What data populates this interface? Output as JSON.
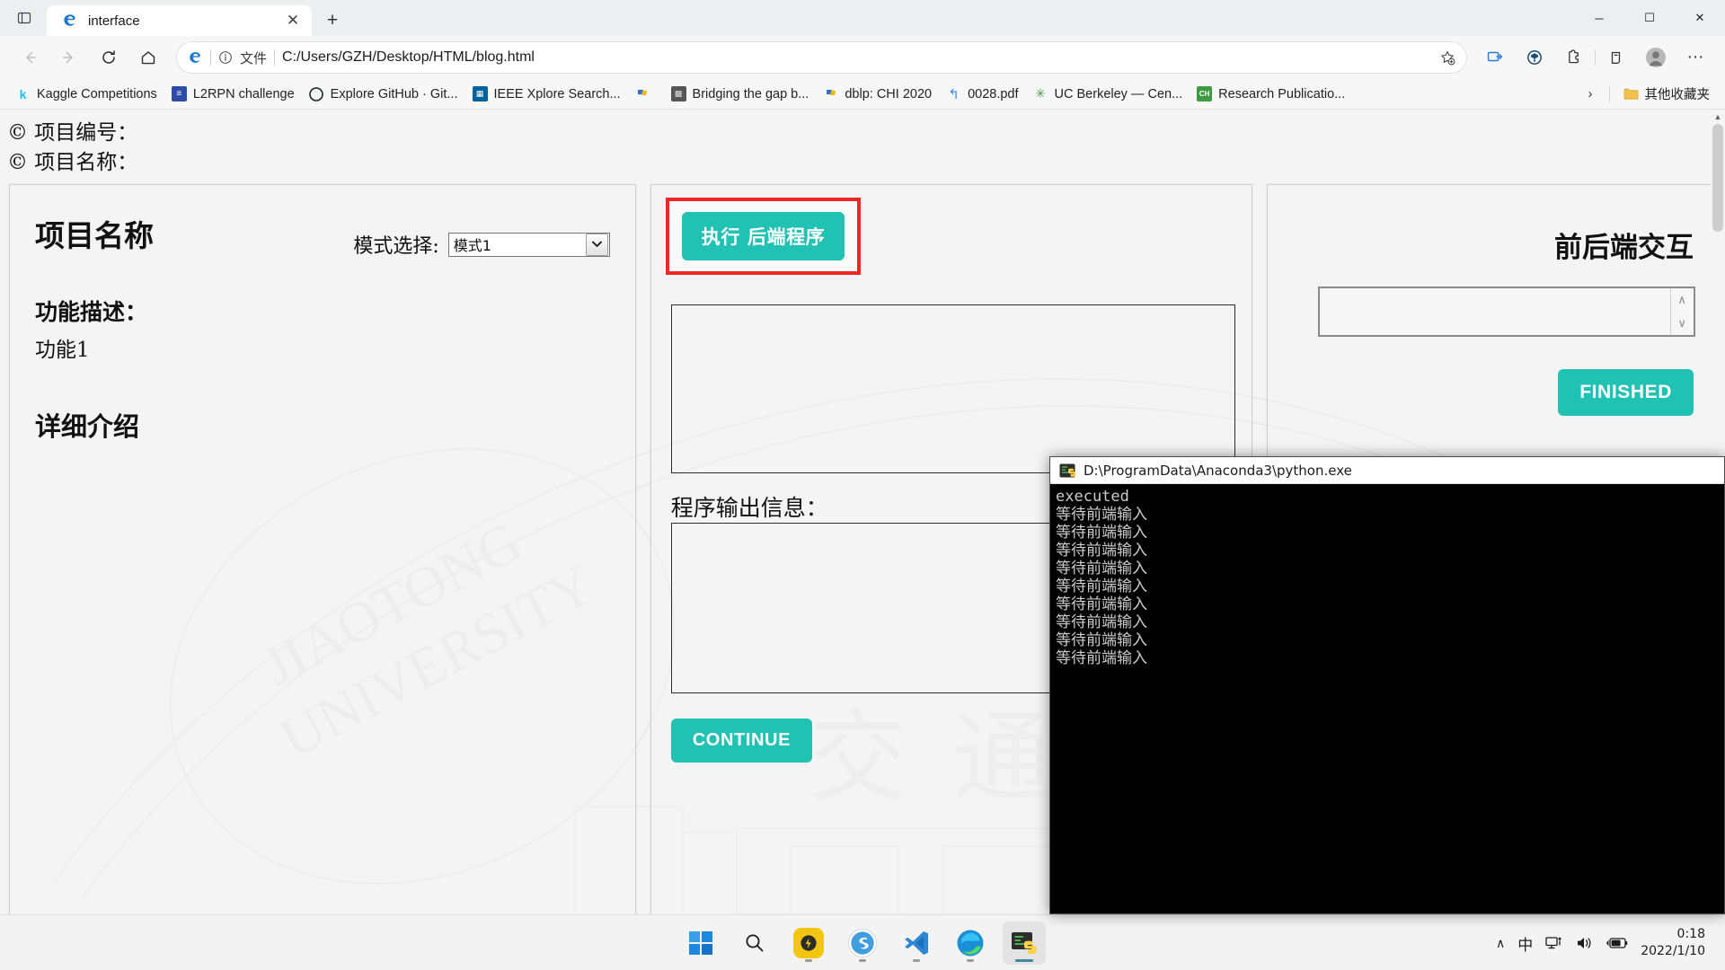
{
  "browser": {
    "tab": {
      "title": "interface",
      "favicon": "ie-edge-legacy-icon",
      "close_label": "✕"
    },
    "new_tab_label": "+",
    "tab_list_icon": "tab-list-icon",
    "window_controls": {
      "minimize": "─",
      "maximize": "☐",
      "close": "✕"
    },
    "toolbar": {
      "back": "←",
      "forward": "→",
      "refresh": "⟳",
      "home": "⌂",
      "site_icon": "ie-compat-icon",
      "info_icon": "ⓘ",
      "file_label": "文件",
      "url": "C:/Users/GZH/Desktop/HTML/blog.html",
      "star_icon": "add-favorite-icon",
      "collections": "collections-icon",
      "browser_essentials": "browser-essentials-icon",
      "extensions": "extensions-icon",
      "split_screen": "split-screen-icon",
      "profile": "profile-avatar",
      "settings_more": "···"
    },
    "bookmarks": [
      {
        "label": "Kaggle Competitions",
        "icon": "kaggle-icon",
        "color": "#20beff",
        "glyph": "k"
      },
      {
        "label": "L2RPN challenge",
        "icon": "l2rpn-icon",
        "color": "#2f4ba8",
        "glyph": "▤"
      },
      {
        "label": "Explore GitHub · Git...",
        "icon": "github-icon",
        "color": "#1b1f23",
        "glyph": "●"
      },
      {
        "label": "IEEE Xplore Search...",
        "icon": "ieee-icon",
        "color": "#00629b",
        "glyph": "█"
      },
      {
        "label": "",
        "icon": "bookmark-flag-icon",
        "color": "#2f6fd0",
        "glyph": "◤"
      },
      {
        "label": "Bridging the gap b...",
        "icon": "document-thumb-icon",
        "color": "#777777",
        "glyph": "▩"
      },
      {
        "label": "dblp: CHI 2020",
        "icon": "bookmark-flag-icon",
        "color": "#2f6fd0",
        "glyph": "◤"
      },
      {
        "label": "0028.pdf",
        "icon": "redirect-arrow-icon",
        "color": "#3b8ae8",
        "glyph": "↩"
      },
      {
        "label": "UC Berkeley — Cen...",
        "icon": "berkeley-icon",
        "color": "#43a047",
        "glyph": "✽"
      },
      {
        "label": "Research Publicatio...",
        "icon": "research-icon",
        "color": "#3f9b42",
        "glyph": "CH"
      }
    ],
    "bookmarks_overflow_icon": "›",
    "other_favorites": {
      "label": "其他收藏夹",
      "icon": "folder-icon"
    }
  },
  "page": {
    "header_lines": [
      "© 项目编号：",
      "© 项目名称："
    ],
    "left_panel": {
      "title": "项目名称",
      "feature_heading": "功能描述：",
      "feature_text": "功能1",
      "detail_heading": "详细介绍",
      "mode_label": "模式选择:",
      "mode_value": "模式1",
      "mode_options": [
        "模式1"
      ],
      "mode_arrow": "⌄"
    },
    "mid_panel": {
      "exec_button": "执行 后端程序",
      "highlight_color": "#ef2626",
      "output_label": "程序输出信息：",
      "input_box_value": "",
      "output_box_value": "",
      "continue_button": "CONTINUE"
    },
    "right_panel": {
      "title": "前后端交互",
      "input_value": "",
      "spin_up": "∧",
      "spin_down": "∨",
      "finished_button": "FINISHED"
    },
    "accent_color": "#21c1b4"
  },
  "console": {
    "title": "D:\\ProgramData\\Anaconda3\\python.exe",
    "icon": "python-console-icon",
    "lines": [
      "executed",
      "等待前端输入",
      "等待前端输入",
      "等待前端输入",
      "等待前端输入",
      "等待前端输入",
      "等待前端输入",
      "等待前端输入",
      "等待前端输入",
      "等待前端输入"
    ]
  },
  "taskbar": {
    "apps": [
      {
        "name": "start-button",
        "icon": "windows-logo-icon"
      },
      {
        "name": "search-button",
        "icon": "search-icon"
      },
      {
        "name": "taskbar-app-yellow",
        "icon": "deepl-icon"
      },
      {
        "name": "taskbar-app-sogou",
        "icon": "sogou-icon"
      },
      {
        "name": "taskbar-app-vscode",
        "icon": "vscode-icon"
      },
      {
        "name": "taskbar-app-edge",
        "icon": "edge-icon"
      },
      {
        "name": "taskbar-app-python",
        "icon": "python-terminal-icon"
      }
    ],
    "tray": {
      "chevron": "∧",
      "ime": "中",
      "network_icon": "network-icon",
      "volume_icon": "volume-icon",
      "battery_icon": "battery-charging-icon",
      "time": "0:18",
      "date": "2022/1/10"
    }
  }
}
